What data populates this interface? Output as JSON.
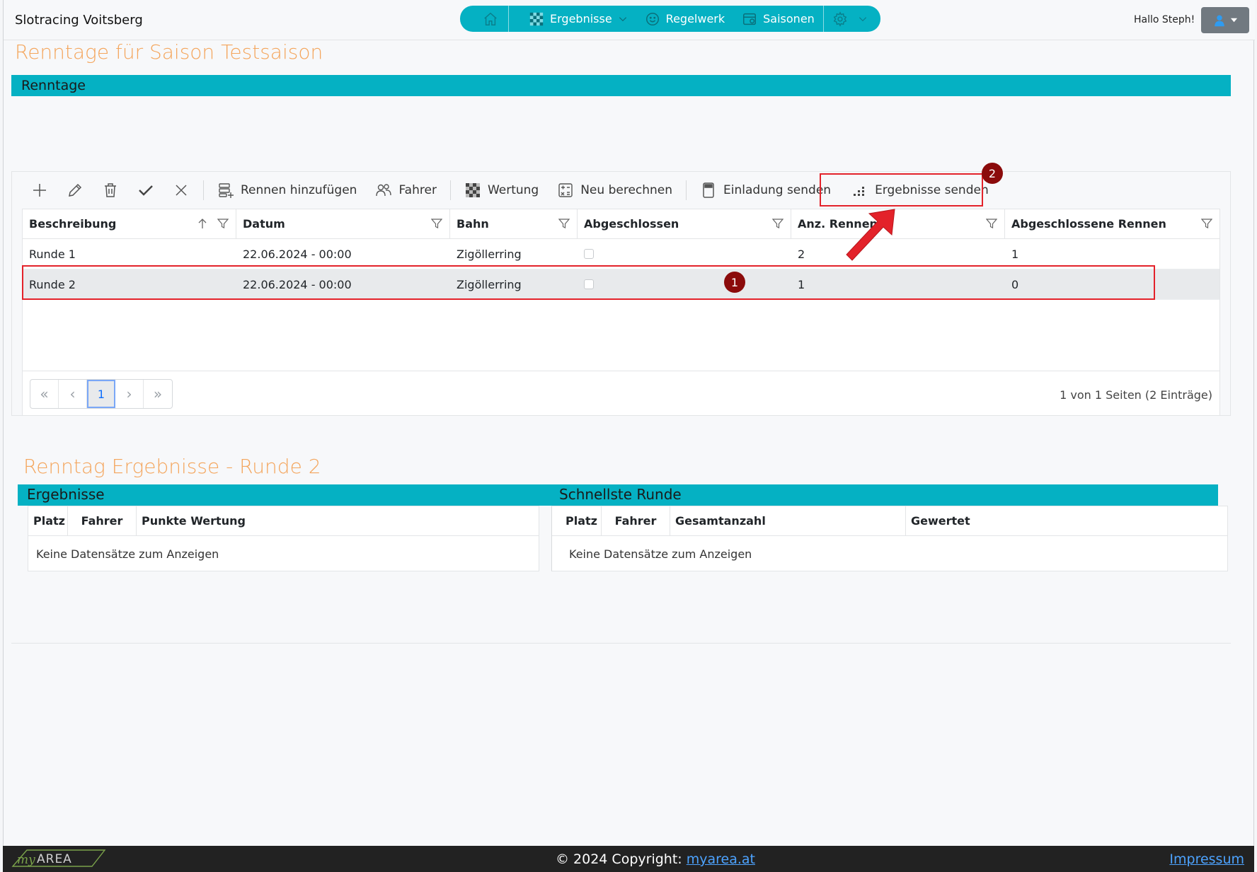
{
  "header": {
    "brand": "Slotracing Voitsberg",
    "nav": [
      {
        "icon": "home-icon",
        "label": ""
      },
      {
        "icon": "checkered-flag-icon",
        "label": "Ergebnisse"
      },
      {
        "icon": "smiley-icon",
        "label": "Regelwerk"
      },
      {
        "icon": "calendar-icon",
        "label": "Saisonen"
      },
      {
        "icon": "gear-icon",
        "label": ""
      }
    ],
    "greeting": "Hallo Steph!"
  },
  "page_title": "Renntage für Saison Testsaison",
  "section_title": "Renntage",
  "toolbar": {
    "rennen_hinzufuegen": "Rennen hinzufügen",
    "fahrer": "Fahrer",
    "wertung": "Wertung",
    "neu_berechnen": "Neu berechnen",
    "einladung_senden": "Einladung senden",
    "ergebnisse_senden": "Ergebnisse senden"
  },
  "grid": {
    "columns": [
      "Beschreibung",
      "Datum",
      "Bahn",
      "Abgeschlossen",
      "Anz. Rennen",
      "Abgeschlossene Rennen"
    ],
    "rows": [
      {
        "beschreibung": "Runde 1",
        "datum": "22.06.2024 - 00:00",
        "bahn": "Zigöllerring",
        "abgeschlossen": false,
        "anz": "2",
        "abg": "1"
      },
      {
        "beschreibung": "Runde 2",
        "datum": "22.06.2024 - 00:00",
        "bahn": "Zigöllerring",
        "abgeschlossen": false,
        "anz": "1",
        "abg": "0"
      }
    ],
    "pager": {
      "first": "«",
      "prev": "‹",
      "current": "1",
      "next": "›",
      "last": "»",
      "info": "1 von 1 Seiten (2 Einträge)"
    }
  },
  "results": {
    "title": "Renntag Ergebnisse - Runde 2",
    "ergebnisse": {
      "title": "Ergebnisse",
      "columns": [
        "Platz",
        "Fahrer",
        "Punkte Wertung"
      ],
      "empty": "Keine Datensätze zum Anzeigen"
    },
    "schnellste": {
      "title": "Schnellste Runde",
      "columns": [
        "Platz",
        "Fahrer",
        "Gesamtanzahl",
        "Gewertet"
      ],
      "empty": "Keine Datensätze zum Anzeigen"
    }
  },
  "annotations": {
    "badge1": "1",
    "badge2": "2"
  },
  "footer": {
    "copyright_prefix": "© 2024 Copyright: ",
    "copyright_link": "myarea.at",
    "impressum": "Impressum",
    "logo_text": "myAREA"
  },
  "colors": {
    "accent": "#05b1c3",
    "title": "#f4a55c",
    "annotation": "#e3222a",
    "badge": "#8b0b0b"
  }
}
